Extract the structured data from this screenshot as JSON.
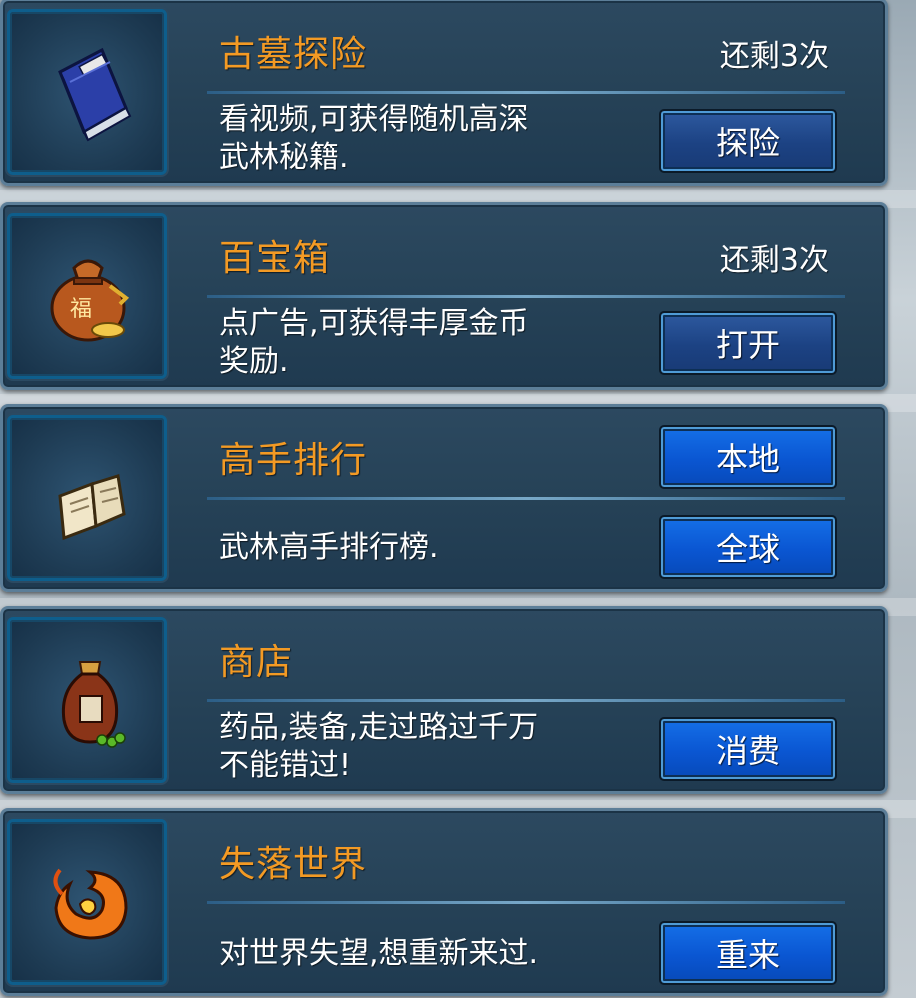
{
  "colors": {
    "title": "#f39a24",
    "text": "#ffffff",
    "card": "#264257",
    "button_active": "#0a56d2",
    "button_dim": "#1c4283"
  },
  "cards": [
    {
      "title": "古墓探险",
      "remaining": "还剩3次",
      "desc_line1": "看视频,可获得随机高深",
      "desc_line2": "武林秘籍.",
      "button": "探险",
      "icon": "book-scroll-icon"
    },
    {
      "title": "百宝箱",
      "remaining": "还剩3次",
      "desc_line1": "点广告,可获得丰厚金币",
      "desc_line2": "奖励.",
      "button": "打开",
      "icon": "treasure-bag-icon"
    },
    {
      "title": "高手排行",
      "desc_line1": "武林高手排行榜.",
      "button_local": "本地",
      "button_global": "全球",
      "icon": "open-book-icon"
    },
    {
      "title": "商店",
      "desc_line1": "药品,装备,走过路过千万",
      "desc_line2": "不能错过!",
      "button": "消费",
      "icon": "potion-jar-icon"
    },
    {
      "title": "失落世界",
      "desc_line1": "对世界失望,想重新来过.",
      "button": "重来",
      "icon": "fire-swirl-icon"
    }
  ]
}
